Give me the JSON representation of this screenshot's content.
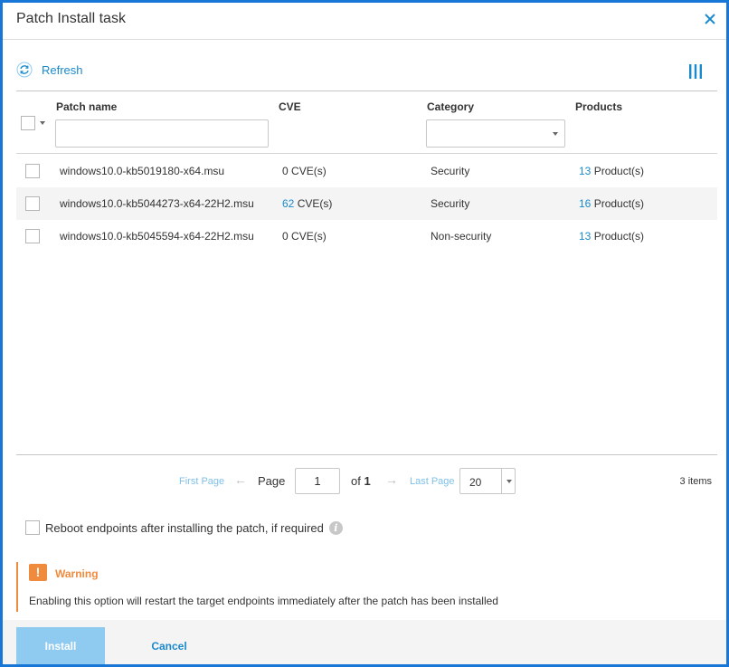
{
  "dialog": {
    "title": "Patch Install task",
    "close_icon": "close-icon"
  },
  "toolbar": {
    "refresh_label": "Refresh",
    "refresh_icon": "refresh-icon",
    "columns_icon": "column-selector-icon"
  },
  "table": {
    "headers": {
      "patch_name": "Patch name",
      "cve": "CVE",
      "category": "Category",
      "products": "Products"
    },
    "filters": {
      "patch_name_value": "",
      "category_value": ""
    },
    "rows": [
      {
        "patch_name": "windows10.0-kb5019180-x64.msu",
        "cve_count": "0",
        "cve_suffix": " CVE(s)",
        "cve_is_link": false,
        "category": "Security",
        "product_count": "13",
        "product_suffix": " Product(s)"
      },
      {
        "patch_name": "windows10.0-kb5044273-x64-22H2.msu",
        "cve_count": "62",
        "cve_suffix": " CVE(s)",
        "cve_is_link": true,
        "category": "Security",
        "product_count": "16",
        "product_suffix": " Product(s)"
      },
      {
        "patch_name": "windows10.0-kb5045594-x64-22H2.msu",
        "cve_count": "0",
        "cve_suffix": " CVE(s)",
        "cve_is_link": false,
        "category": "Non-security",
        "product_count": "13",
        "product_suffix": " Product(s)"
      }
    ]
  },
  "pager": {
    "first_page": "First Page",
    "prev_arrow": "←",
    "page_label": "Page",
    "page_value": "1",
    "of_label": "of",
    "total_pages": "1",
    "next_arrow": "→",
    "last_page": "Last Page",
    "page_size": "20",
    "items_count": "3 items"
  },
  "reboot": {
    "label": "Reboot endpoints after installing the patch, if required",
    "checked": false,
    "info_glyph": "i"
  },
  "warning": {
    "icon_glyph": "!",
    "title": "Warning",
    "text": "Enabling this option will restart the target endpoints immediately after the patch has been installed"
  },
  "footer": {
    "install_label": "Install",
    "cancel_label": "Cancel"
  },
  "colors": {
    "accent": "#1a8acc",
    "frame_border": "#1877d6",
    "warning": "#f08a3c",
    "install_button": "#8fcaf0"
  }
}
